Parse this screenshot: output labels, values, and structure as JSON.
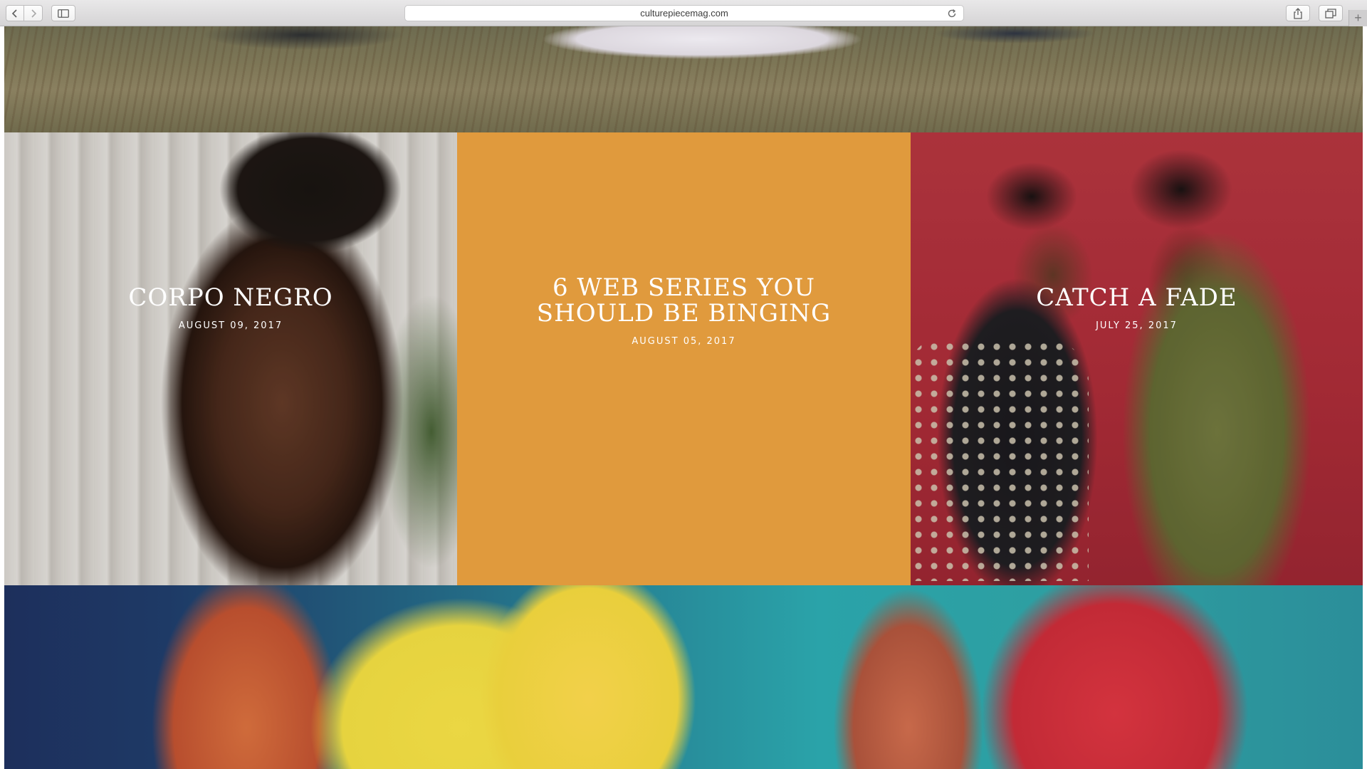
{
  "browser": {
    "url": "culturepiecemag.com",
    "back_icon": "chevron-left",
    "forward_icon": "chevron-right",
    "sidebar_icon": "sidebar",
    "reload_icon": "reload",
    "share_icon": "share",
    "tabs_icon": "tabs",
    "new_tab_label": "+"
  },
  "articles": [
    {
      "title": "CORPO NEGRO",
      "date": "AUGUST 09, 2017"
    },
    {
      "title": "6 WEB SERIES YOU SHOULD BE BINGING",
      "date": "AUGUST 05, 2017",
      "background": "#e09a3d"
    },
    {
      "title": "CATCH A FADE",
      "date": "JULY 25, 2017",
      "background": "#c33a44"
    }
  ]
}
